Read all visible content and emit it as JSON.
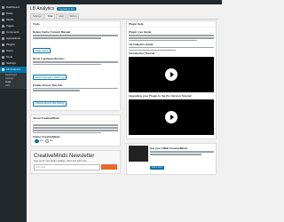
{
  "sidebar": {
    "items": [
      {
        "label": "Dashboard"
      },
      {
        "label": "Posts"
      },
      {
        "label": "Media"
      },
      {
        "label": "Pages"
      },
      {
        "label": "Comments"
      },
      {
        "label": "Appearance"
      },
      {
        "label": "Plugins"
      },
      {
        "label": "Users"
      },
      {
        "label": "Tools"
      },
      {
        "label": "Settings"
      }
    ],
    "active": {
      "label": "LB Analytics"
    },
    "submenu": [
      "Dashboard",
      "Settings",
      "Tools",
      "Help"
    ]
  },
  "header": {
    "title": "LB Analytics",
    "upgrade_label": "Upgrade to Pro"
  },
  "tabs": [
    {
      "label": "Settings"
    },
    {
      "label": "Tools"
    },
    {
      "label": "Help"
    },
    {
      "label": "Debug"
    }
  ],
  "left": {
    "panel1": {
      "title": "Tools",
      "s1_title": "Delete Cache Content Manual",
      "s1_btn": "Clear Cache",
      "s2_title": "Reset Log Dependencies",
      "s2_btn": "Export Licenses / Reset Log",
      "s3_title": "Enable Ensure Site Info",
      "s3_btn": "Change Ensure Site Setting"
    },
    "panel2": {
      "title": "About CreativeMinds",
      "s_title": "Follow CreativeMinds",
      "radio_on": "Yes",
      "radio_off": "No"
    },
    "newsletter": {
      "title": "CreativeMinds Newsletter",
      "subtitle": "Sign up for new plugin updates, discounts and more",
      "placeholder": "Your email"
    }
  },
  "right": {
    "panel1": {
      "title": "Plugin Help",
      "s1_title": "Plugin Live Guide",
      "s2_title": "LB Analytics Guide",
      "video1_title": "Introduction Tutorial",
      "video2_title": "Upgrading your Plugin to the Pro Version Tutorial"
    },
    "promo": {
      "title": "Get your FREE CreativeMinds",
      "btn": "Get it now"
    }
  }
}
